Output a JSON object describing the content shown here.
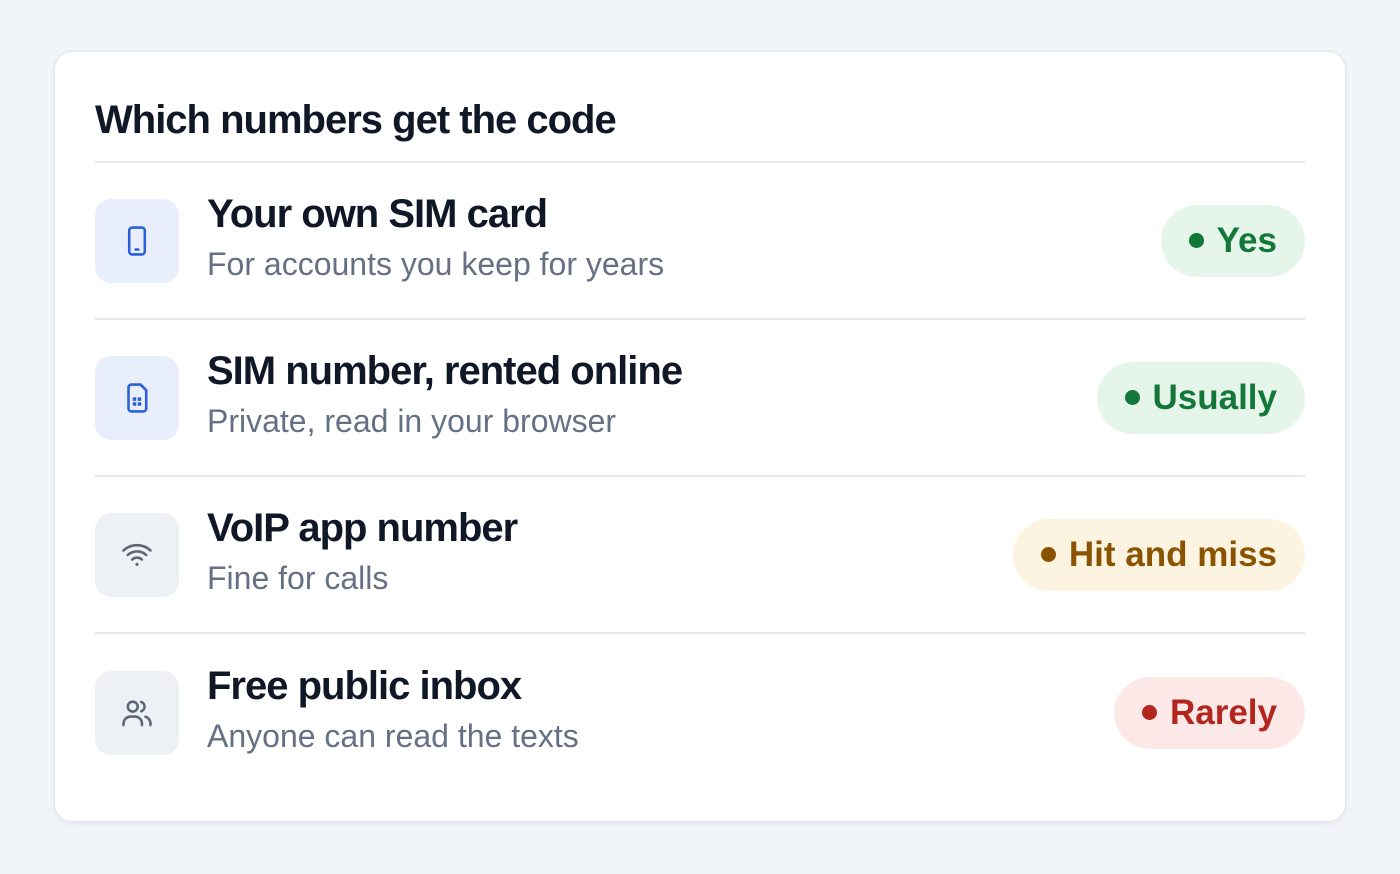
{
  "card": {
    "title": "Which numbers get the code",
    "rows": [
      {
        "icon": "smartphone-icon",
        "title": "Your own SIM card",
        "subtitle": "For accounts you keep for years",
        "badge": "Yes",
        "badge_tone": "green"
      },
      {
        "icon": "sim-card-icon",
        "title": "SIM number, rented online",
        "subtitle": "Private, read in your browser",
        "badge": "Usually",
        "badge_tone": "green"
      },
      {
        "icon": "wifi-icon",
        "title": "VoIP app number",
        "subtitle": "Fine for calls",
        "badge": "Hit and miss",
        "badge_tone": "amber"
      },
      {
        "icon": "users-icon",
        "title": "Free public inbox",
        "subtitle": "Anyone can read the texts",
        "badge": "Rarely",
        "badge_tone": "red"
      }
    ]
  },
  "colors": {
    "page_background": "#f1f4f9",
    "card_background": "#ffffff",
    "heading_text": "#101828",
    "muted_text": "#667085",
    "icon_blue": "#2b5fd9",
    "icon_gray": "#5b6677",
    "green_badge_bg": "#e6f5ea",
    "green_badge_text": "#13773a",
    "amber_badge_bg": "#fdf3e1",
    "amber_badge_text": "#8a5300",
    "red_badge_bg": "#fde8e8",
    "red_badge_text": "#b3261e"
  }
}
